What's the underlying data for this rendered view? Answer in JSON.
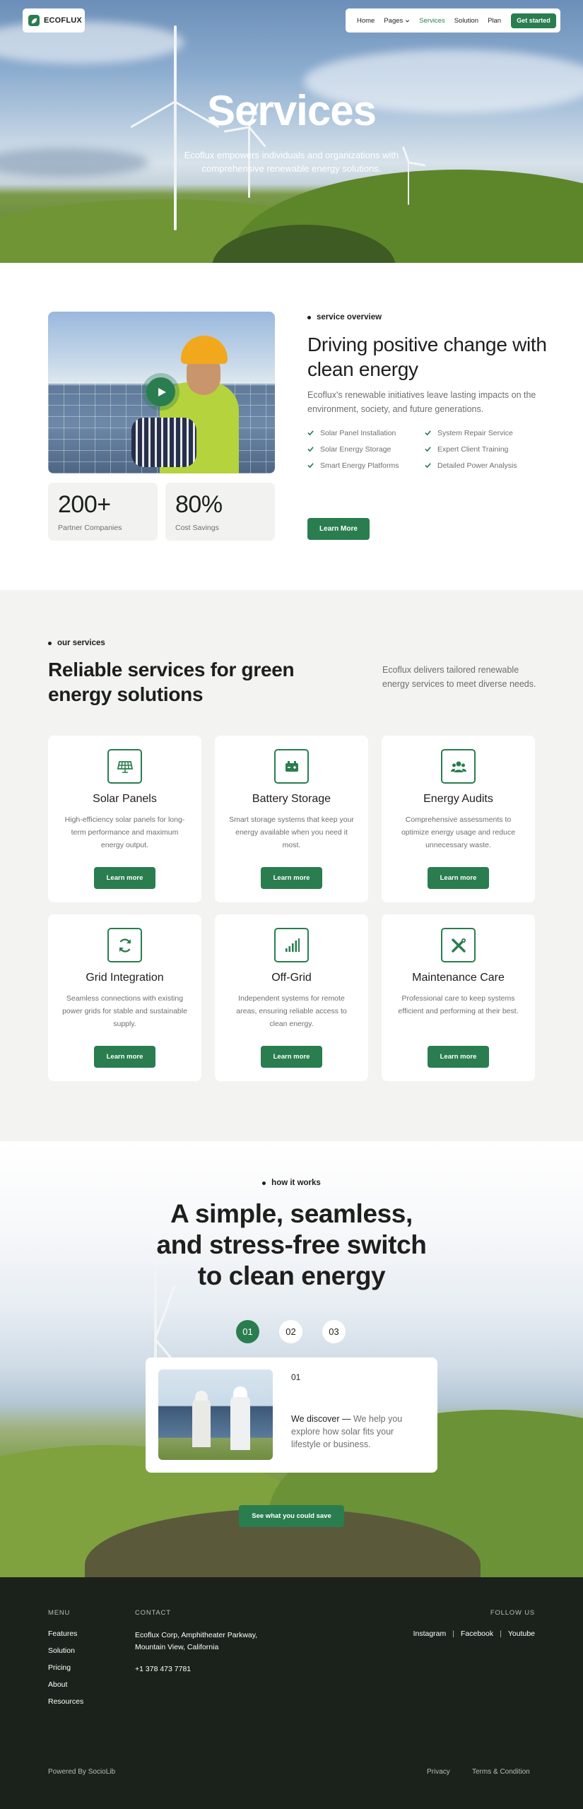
{
  "brand": {
    "name": "ECOFLUX",
    "accent": "#2a7d4f"
  },
  "nav": {
    "items": [
      {
        "label": "Home",
        "icon": ""
      },
      {
        "label": "Pages",
        "icon": "chevron-down-icon"
      },
      {
        "label": "Services",
        "icon": ""
      },
      {
        "label": "Solution",
        "icon": ""
      },
      {
        "label": "Plan",
        "icon": ""
      }
    ],
    "active": "Services",
    "cta": "Get started"
  },
  "hero": {
    "title": "Services",
    "subtitle": "Ecoflux empowers individuals and organizations with comprehensive renewable energy solutions."
  },
  "overview": {
    "eyebrow": "service overview",
    "title": "Driving positive change with clean energy",
    "description": "Ecoflux's renewable initiatives leave lasting impacts on the environment, society, and future generations.",
    "features_left": [
      "Solar Panel Installation",
      "Solar Energy Storage",
      "Smart Energy Platforms"
    ],
    "features_right": [
      "System Repair Service",
      "Expert Client Training",
      "Detailed Power Analysis"
    ],
    "button": "Learn More",
    "stats": [
      {
        "value": "200+",
        "label": "Partner Companies"
      },
      {
        "value": "80%",
        "label": "Cost Savings"
      }
    ]
  },
  "services": {
    "eyebrow": "our services",
    "title": "Reliable services for green energy solutions",
    "description": "Ecoflux delivers tailored renewable energy services to meet diverse needs.",
    "cards": [
      {
        "icon": "solar-panel-icon",
        "title": "Solar Panels",
        "text": "High-efficiency solar panels for long-term performance and maximum energy output.",
        "button": "Learn more"
      },
      {
        "icon": "battery-icon",
        "title": "Battery Storage",
        "text": "Smart storage systems that keep your energy available when you need it most.",
        "button": "Learn more"
      },
      {
        "icon": "users-icon",
        "title": "Energy Audits",
        "text": "Comprehensive assessments to optimize energy usage and reduce unnecessary waste.",
        "button": "Learn more"
      },
      {
        "icon": "sync-icon",
        "title": "Grid Integration",
        "text": "Seamless connections with existing power grids for stable and sustainable supply.",
        "button": "Learn more"
      },
      {
        "icon": "signal-bars-icon",
        "title": "Off-Grid",
        "text": "Independent systems for remote areas, ensuring reliable access to clean energy.",
        "button": "Learn more"
      },
      {
        "icon": "tools-icon",
        "title": "Maintenance Care",
        "text": "Professional care to keep systems efficient and performing at their best.",
        "button": "Learn more"
      }
    ]
  },
  "how": {
    "eyebrow": "how it works",
    "title_lines": [
      "A simple, seamless,",
      "and stress-free switch",
      "to clean energy"
    ],
    "steps": [
      "01",
      "02",
      "03"
    ],
    "active_step": "01",
    "card": {
      "number": "01",
      "lead": "We discover —",
      "text": " We help you explore how solar fits your lifestyle or business."
    },
    "button": "See what you could save"
  },
  "footer": {
    "menu_heading": "MENU",
    "menu": [
      "Features",
      "Solution",
      "Pricing",
      "About",
      "Resources"
    ],
    "contact_heading": "CONTACT",
    "address": "Ecoflux Corp, Amphitheater Parkway, Mountain View, California",
    "phone": "+1 378 473 7781",
    "follow_heading": "FOLLOW US",
    "social": [
      "Instagram",
      "Facebook",
      "Youtube"
    ],
    "powered": "Powered By SocioLib",
    "links": [
      "Privacy",
      "Terms & Condition"
    ]
  }
}
